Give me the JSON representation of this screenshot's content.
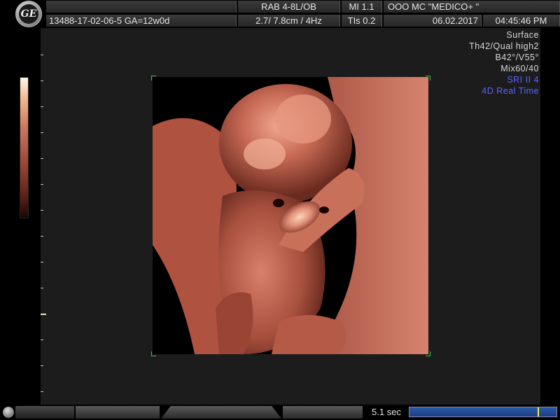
{
  "brand": {
    "logo_text": "GE"
  },
  "header": {
    "probe": "RAB 4-8L/OB",
    "mi": "MI  1.1",
    "institution": "OOO  MC \"MEDICO+ \"",
    "patient_id": "13488-17-02-06-5  GA=12w0d",
    "depth_freq": "2.7/ 7.8cm /  4Hz",
    "tis": "TIs  0.2",
    "date": "06.02.2017",
    "time": "04:45:46 PM"
  },
  "params": [
    {
      "text": "Surface",
      "color": "#d8d8d8"
    },
    {
      "text": "Th42/Qual high2",
      "color": "#d8d8d8"
    },
    {
      "text": "B42°/V55°",
      "color": "#d8d8d8"
    },
    {
      "text": "Mix60/40",
      "color": "#d8d8d8"
    },
    {
      "text": "SRI II 4",
      "color": "#5a64ff"
    },
    {
      "text": "4D Real Time",
      "color": "#5a64ff"
    }
  ],
  "cine": {
    "duration": "5.1 sec",
    "position_fraction": 0.87
  },
  "colors": {
    "render_tint": "#b85a48",
    "roi_corner": "#33cc33",
    "cine_bar": "#2c5aa8"
  },
  "icons": [
    "ge-logo-icon",
    "trackball-knob-icon"
  ]
}
